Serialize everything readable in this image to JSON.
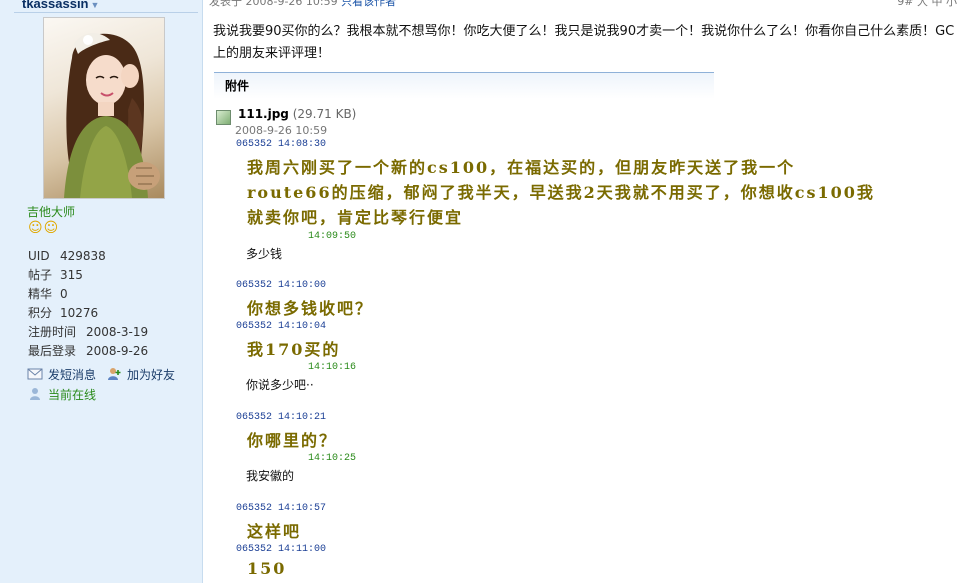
{
  "user": {
    "name": "tkassassin",
    "rank": "吉他大师",
    "stats": [
      {
        "k": "UID",
        "v": "429838"
      },
      {
        "k": "帖子",
        "v": "315"
      },
      {
        "k": "精华",
        "v": "0"
      },
      {
        "k": "积分",
        "v": "10276"
      },
      {
        "k": "注册时间",
        "v": "2008-3-19"
      },
      {
        "k": "最后登录",
        "v": "2008-9-26"
      }
    ],
    "send_msg": "发短消息",
    "add_friend": "加为好友",
    "status": "当前在线"
  },
  "post": {
    "header_fragment": "发表于 2008-9-26 10:59",
    "header_link": "只看该作者",
    "header_right": "9# 大 中 小",
    "message": "我说我要90买你的么？我根本就不想骂你！你吃大便了么！我只是说我90才卖一个！我说你什么了么！你看你自己什么素质！GC上的朋友来评评理！",
    "attach_title": "附件",
    "attachment": {
      "name": "111.jpg",
      "size": "(29.71 KB)",
      "date": "2008-9-26 10:59"
    }
  },
  "chat": [
    {
      "type": "ts",
      "text": "065352  14:08:30"
    },
    {
      "type": "big",
      "text": "我周六刚买了一个新的cs100，在福达买的，但朋友昨天送了我一个"
    },
    {
      "type": "big",
      "text": "route66的压缩，郁闷了我半天，早送我2天我就不用买了，你想收cs100我"
    },
    {
      "type": "big",
      "text": "就卖你吧，肯定比琴行便宜"
    },
    {
      "type": "ts2",
      "text": "14:09:50"
    },
    {
      "type": "small",
      "text": "多少钱"
    },
    {
      "type": "ts",
      "text": "065352  14:10:00"
    },
    {
      "type": "big",
      "text": "你想多钱收吧？"
    },
    {
      "type": "ts",
      "text": "065352  14:10:04"
    },
    {
      "type": "big",
      "text": "我170买的"
    },
    {
      "type": "ts2",
      "text": "14:10:16"
    },
    {
      "type": "small",
      "text": "你说多少吧··"
    },
    {
      "type": "ts",
      "text": "065352  14:10:21"
    },
    {
      "type": "big",
      "text": "你哪里的？"
    },
    {
      "type": "ts2",
      "text": "14:10:25"
    },
    {
      "type": "small",
      "text": "我安徽的"
    },
    {
      "type": "ts",
      "text": "065352  14:10:57"
    },
    {
      "type": "big",
      "text": "这样吧"
    },
    {
      "type": "ts",
      "text": "065352  14:11:00"
    },
    {
      "type": "big",
      "text": "150"
    }
  ]
}
